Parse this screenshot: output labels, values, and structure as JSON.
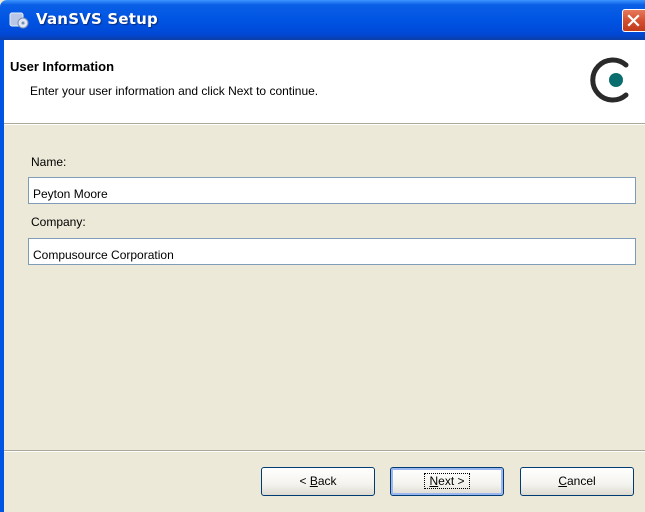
{
  "window": {
    "title": "VanSVS Setup"
  },
  "banner": {
    "title": "User Information",
    "subtitle": "Enter your user information and click Next to continue."
  },
  "form": {
    "name_label": "Name:",
    "name_value": "Peyton Moore",
    "company_label": "Company:",
    "company_value": "Compusource Corporation"
  },
  "buttons": {
    "back_prefix": "< ",
    "back_key": "B",
    "back_rest": "ack",
    "next_key": "N",
    "next_rest": "ext >",
    "cancel_key": "C",
    "cancel_rest": "ancel"
  },
  "colors": {
    "titlebar": "#0054e3",
    "dialog_bg": "#ece9d8",
    "logo": "#0a6e6e"
  }
}
